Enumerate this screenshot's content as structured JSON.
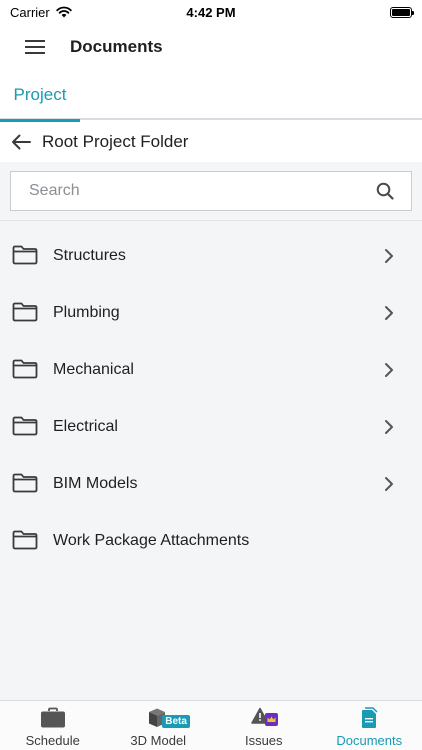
{
  "status_bar": {
    "carrier": "Carrier",
    "time": "4:42 PM"
  },
  "header": {
    "title": "Documents"
  },
  "tabs": [
    {
      "label": "Project",
      "active": true
    }
  ],
  "folder_header": {
    "title": "Root Project Folder"
  },
  "search": {
    "placeholder": "Search",
    "value": ""
  },
  "folders": [
    {
      "name": "Structures",
      "has_children": true
    },
    {
      "name": "Plumbing",
      "has_children": true
    },
    {
      "name": "Mechanical",
      "has_children": true
    },
    {
      "name": "Electrical",
      "has_children": true
    },
    {
      "name": "BIM Models",
      "has_children": true
    },
    {
      "name": "Work Package Attachments",
      "has_children": false
    }
  ],
  "bottom_tabs": [
    {
      "label": "Schedule",
      "icon": "briefcase-icon",
      "active": false
    },
    {
      "label": "3D Model",
      "icon": "cube-icon",
      "badge": "Beta",
      "active": false
    },
    {
      "label": "Issues",
      "icon": "warning-icon",
      "badge_icon": "crown-icon",
      "active": false
    },
    {
      "label": "Documents",
      "icon": "document-icon",
      "active": true
    }
  ],
  "colors": {
    "accent": "#1a9ab5",
    "premium": "#6b2fbf",
    "background": "#f4f5f7",
    "text": "#1f1f1f"
  }
}
